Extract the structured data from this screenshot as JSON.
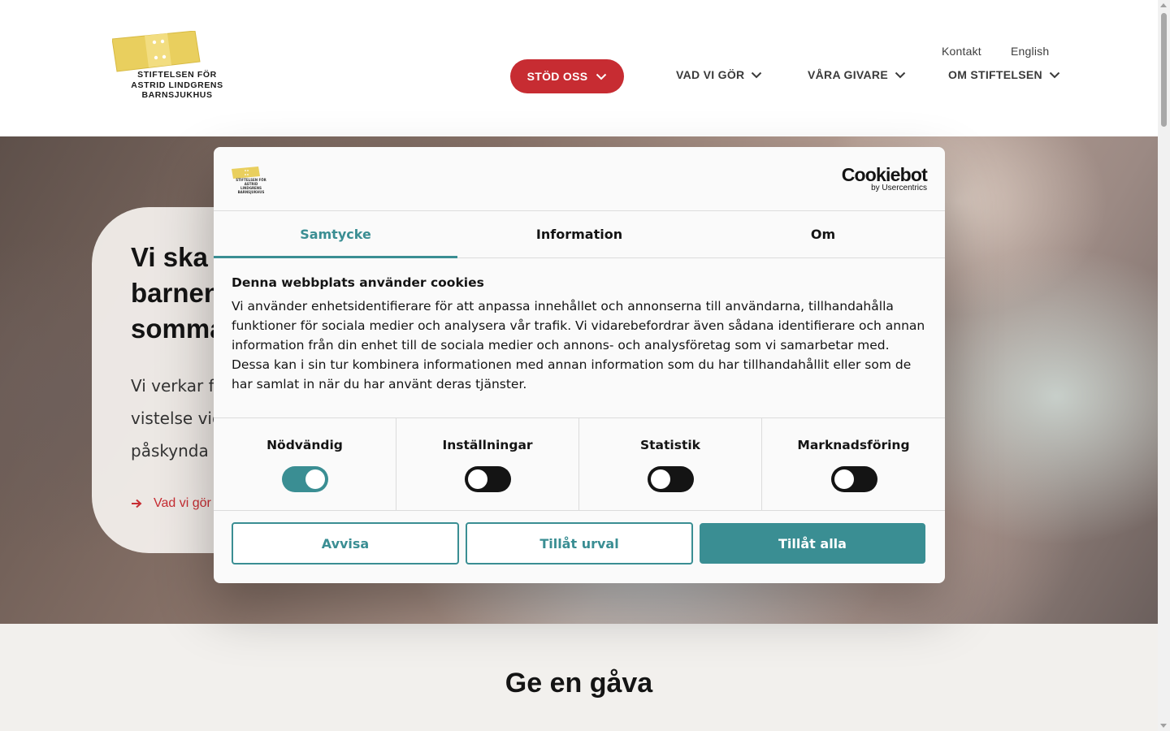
{
  "logo": {
    "lines": [
      "STIFTELSEN FÖR",
      "ASTRID LINDGRENS",
      "BARNSJUKHUS"
    ]
  },
  "utility_nav": {
    "contact": "Kontakt",
    "english": "English"
  },
  "main_nav": {
    "support": "STÖD OSS",
    "what_we_do": "VAD VI GÖR",
    "donors": "VÅRA GIVARE",
    "about": "OM STIFTELSEN"
  },
  "hero": {
    "title_lines": [
      "Vi ska v",
      "barnen",
      "somma"
    ],
    "body_lines": [
      "Vi verkar fö",
      "vistelse vid",
      "påskynda d"
    ],
    "link": "Vad vi gör"
  },
  "below_hero": {
    "title": "Ge en gåva"
  },
  "cookie_dialog": {
    "brand": "Cookiebot",
    "brand_by": "by Usercentrics",
    "tabs": [
      "Samtycke",
      "Information",
      "Om"
    ],
    "active_tab": "Samtycke",
    "heading": "Denna webbplats använder cookies",
    "text": "Vi använder enhetsidentifierare för att anpassa innehållet och annonserna till användarna, tillhandahålla funktioner för sociala medier och analysera vår trafik. Vi vidarebefordrar även sådana identifierare och annan information från din enhet till de sociala medier och annons- och analysföretag som vi samarbetar med. Dessa kan i sin tur kombinera informationen med annan information som du har tillhandahållit eller som de har samlat in när du har använt deras tjänster.",
    "toggles": [
      {
        "label": "Nödvändig",
        "on": true
      },
      {
        "label": "Inställningar",
        "on": false
      },
      {
        "label": "Statistik",
        "on": false
      },
      {
        "label": "Marknadsföring",
        "on": false
      }
    ],
    "buttons": {
      "deny": "Avvisa",
      "allow_selection": "Tillåt urval",
      "allow_all": "Tillåt alla"
    }
  },
  "colors": {
    "brand_red": "#c72c32",
    "teal": "#3a8e93",
    "logo_yellow": "#e9cf5e"
  }
}
